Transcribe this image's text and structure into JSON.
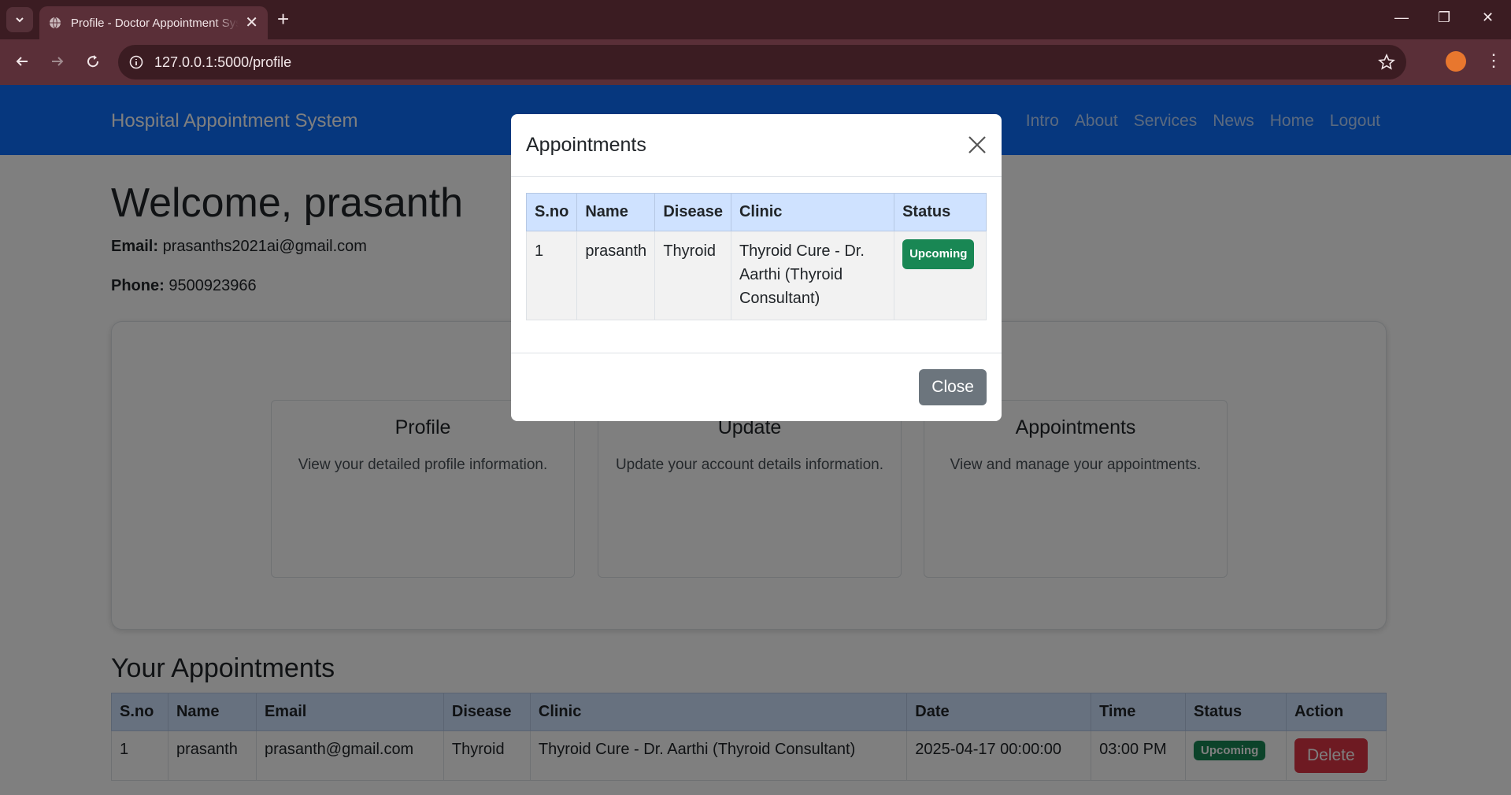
{
  "browser": {
    "tab_title": "Profile - Doctor Appointment System",
    "url": "127.0.0.1:5000/profile"
  },
  "icons": [
    "chevron-down-icon",
    "globe-icon",
    "close-icon",
    "plus-icon",
    "minimize-icon",
    "restore-icon",
    "back-icon",
    "forward-icon",
    "reload-icon",
    "info-icon",
    "star-icon",
    "kebab-menu-icon"
  ],
  "navbar": {
    "brand": "Hospital Appointment System",
    "links": [
      "Intro",
      "About",
      "Services",
      "News",
      "Home",
      "Logout"
    ]
  },
  "profile": {
    "welcome": "Welcome, prasanth",
    "email_label": "Email:",
    "email": "prasanths2021ai@gmail.com",
    "phone_label": "Phone:",
    "phone": "9500923966"
  },
  "cards": [
    {
      "title": "Profile",
      "text": "View your detailed profile information."
    },
    {
      "title": "Update",
      "text": "Update your account details information."
    },
    {
      "title": "Appointments",
      "text": "View and manage your appointments."
    }
  ],
  "appointments_section": {
    "title": "Your Appointments",
    "headers": [
      "S.no",
      "Name",
      "Email",
      "Disease",
      "Clinic",
      "Date",
      "Time",
      "Status",
      "Action"
    ],
    "rows": [
      {
        "sno": "1",
        "name": "prasanth",
        "email": "prasanth@gmail.com",
        "disease": "Thyroid",
        "clinic": "Thyroid Cure - Dr. Aarthi (Thyroid Consultant)",
        "date": "2025-04-17 00:00:00",
        "time": "03:00 PM",
        "status": "Upcoming",
        "action": "Delete"
      }
    ]
  },
  "modal": {
    "title": "Appointments",
    "headers": [
      "S.no",
      "Name",
      "Disease",
      "Clinic",
      "Status"
    ],
    "rows": [
      {
        "sno": "1",
        "name": "prasanth",
        "disease": "Thyroid",
        "clinic": "Thyroid Cure - Dr. Aarthi (Thyroid Consultant)",
        "status": "Upcoming"
      }
    ],
    "close_button": "Close"
  },
  "colors": {
    "navbar": "#0d6efd",
    "badge_success": "#198754",
    "btn_danger": "#dc3545",
    "btn_secondary": "#6c757d",
    "table_header": "#cfe2ff"
  }
}
